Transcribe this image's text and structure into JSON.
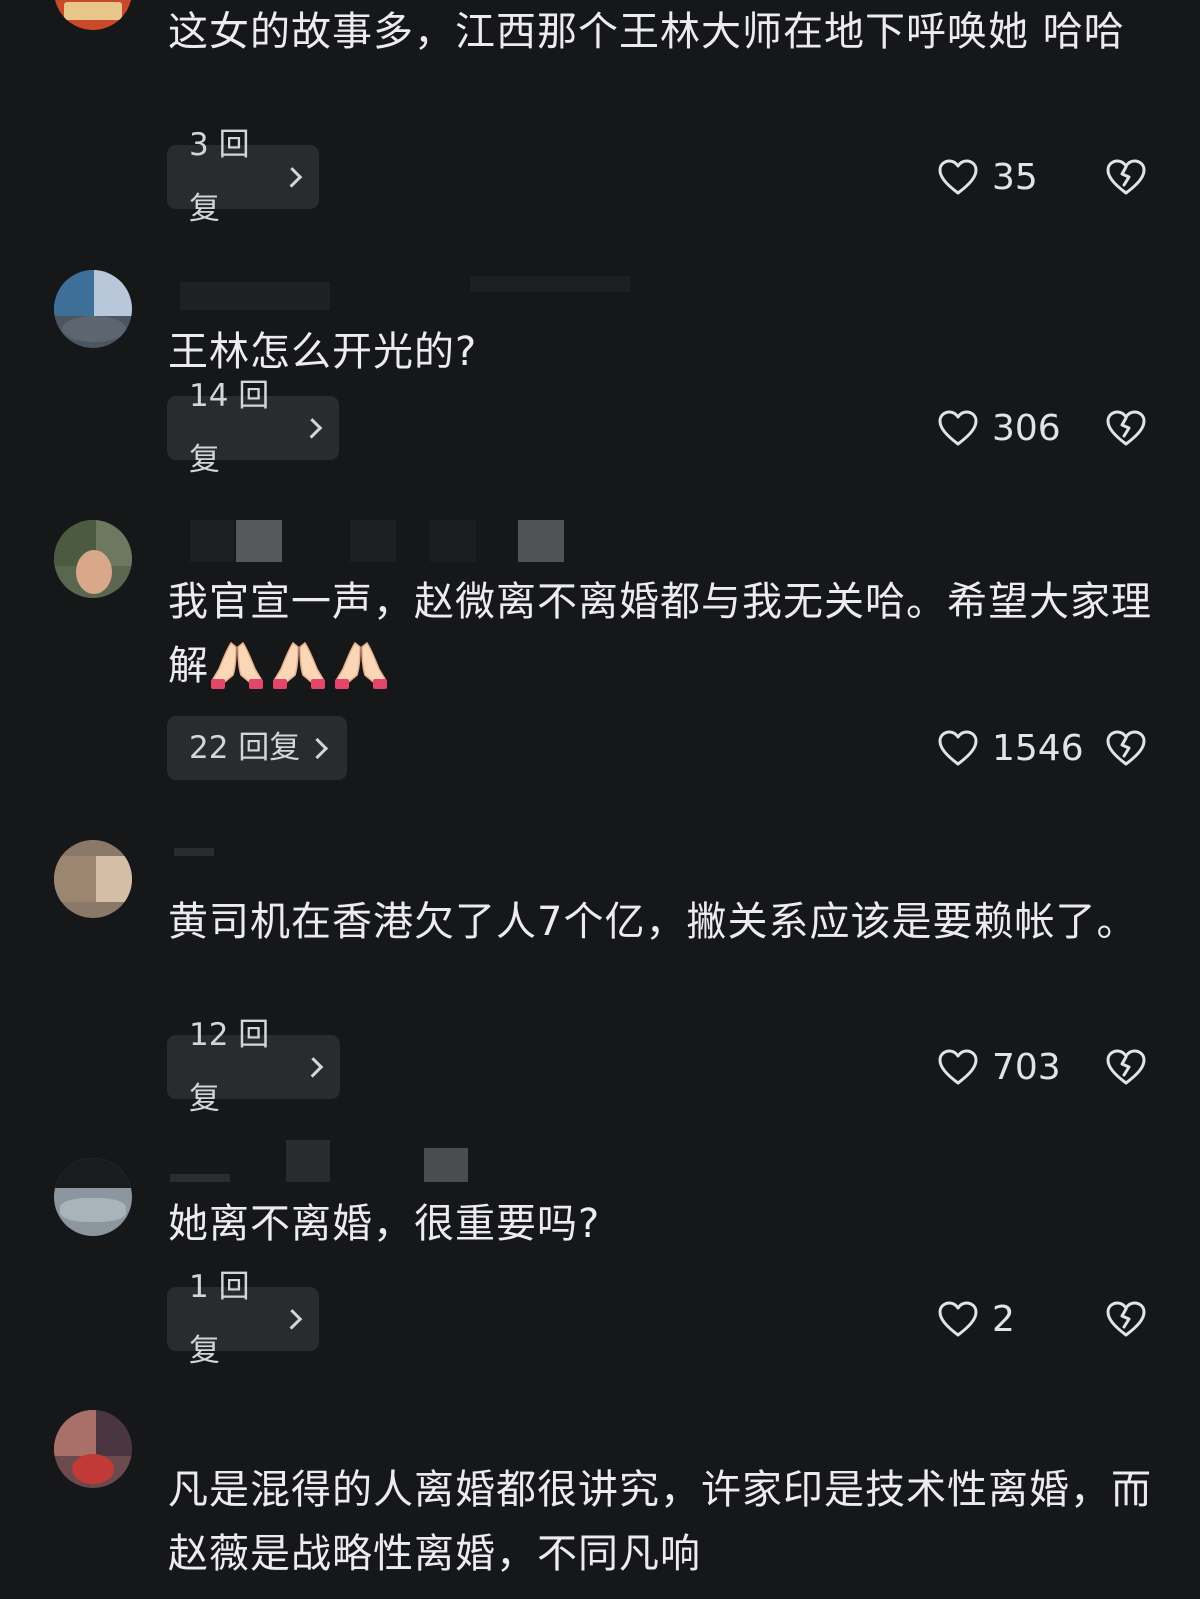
{
  "comments": [
    {
      "text": "这女的故事多，江西那个王林大师在地下呼唤她 哈哈",
      "reply_label": "3 回复",
      "likes": "35"
    },
    {
      "text": "王林怎么开光的?",
      "reply_label": "14 回复",
      "likes": "306"
    },
    {
      "text": "我官宣一声，赵微离不离婚都与我无关哈。希望大家理解",
      "reply_label": "22 回复",
      "likes": "1546"
    },
    {
      "text": "黄司机在香港欠了人7个亿，撇关系应该是要赖帐了。",
      "reply_label": "12 回复",
      "likes": "703"
    },
    {
      "text": "她离不离婚，很重要吗?",
      "reply_label": "1 回复",
      "likes": "2"
    },
    {
      "text": "凡是混得的人离婚都很讲究，许家印是技术性离婚，而赵薇是战略性离婚，不同凡响"
    }
  ],
  "icons": {
    "like": "heart-outline-icon",
    "dislike": "broken-heart-icon",
    "reply_arrow": "chevron-right-icon",
    "emoji": "folded-hands-emoji"
  },
  "colors": {
    "background": "#161719",
    "text": "#ececee",
    "button_bg": "#2a2b2e"
  }
}
